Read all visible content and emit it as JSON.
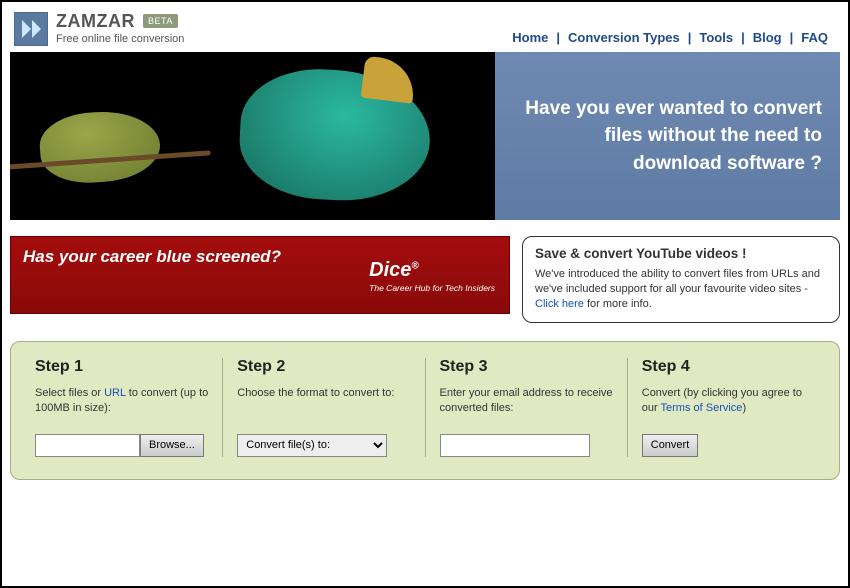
{
  "brand": {
    "name": "ZAMZAR",
    "badge": "BETA",
    "tagline": "Free online file conversion"
  },
  "nav": {
    "items": [
      "Home",
      "Conversion Types",
      "Tools",
      "Blog",
      "FAQ"
    ]
  },
  "hero": {
    "text": "Have you ever wanted to convert files without the need to download software ?"
  },
  "ad": {
    "headline": "Has your career blue screened?",
    "brand": "Dice",
    "brand_sub": "The Career Hub for Tech Insiders"
  },
  "info": {
    "title": "Save & convert YouTube videos !",
    "body_pre": "We've introduced the ability to convert files from URLs and we've included support for all your favourite video sites - ",
    "link": "Click here",
    "body_post": " for more info."
  },
  "steps": [
    {
      "title": "Step 1",
      "desc_pre": "Select files or ",
      "desc_link": "URL",
      "desc_post": " to convert (up to 100MB in size):",
      "browse_label": "Browse..."
    },
    {
      "title": "Step 2",
      "desc": "Choose the format to convert to:",
      "select_label": "Convert file(s) to:"
    },
    {
      "title": "Step 3",
      "desc": "Enter your email address to receive converted files:"
    },
    {
      "title": "Step 4",
      "desc_pre": "Convert (by clicking you agree to our ",
      "desc_link": "Terms of Service",
      "desc_post": ")",
      "button_label": "Convert"
    }
  ]
}
